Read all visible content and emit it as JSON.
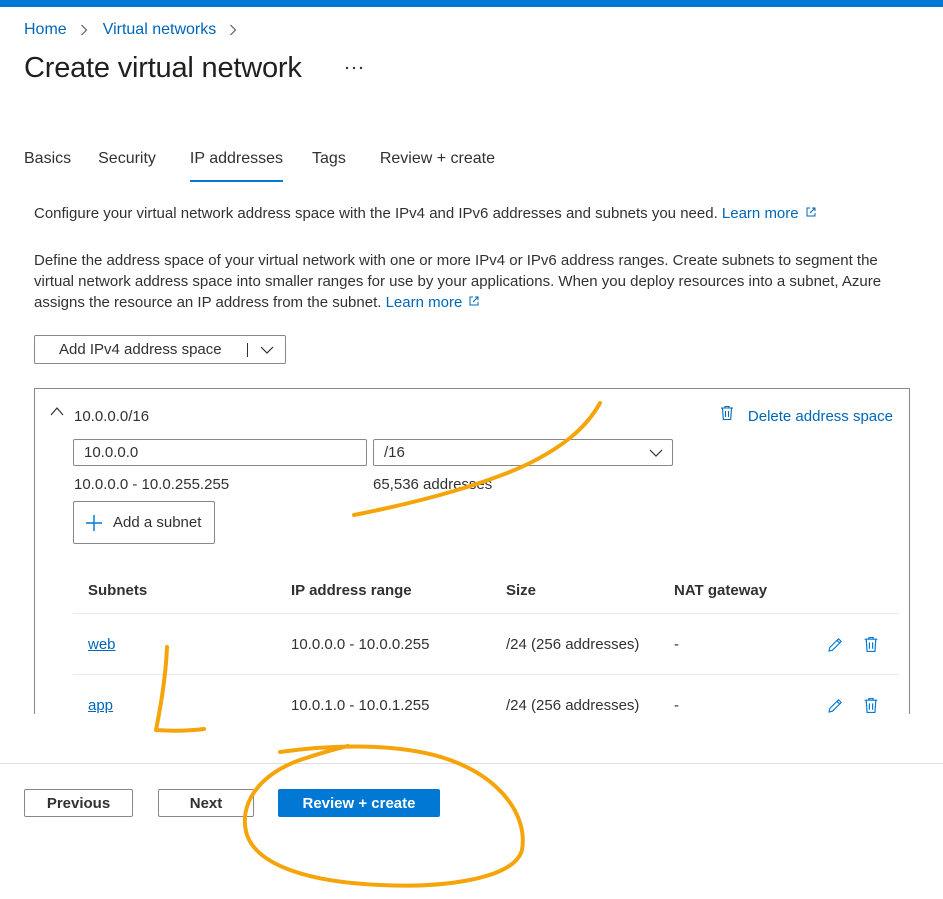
{
  "breadcrumb": {
    "items": [
      "Home",
      "Virtual networks"
    ]
  },
  "page": {
    "title": "Create virtual network",
    "more_label": "···"
  },
  "tabs": [
    {
      "label": "Basics",
      "active": false
    },
    {
      "label": "Security",
      "active": false
    },
    {
      "label": "IP addresses",
      "active": true
    },
    {
      "label": "Tags",
      "active": false
    },
    {
      "label": "Review + create",
      "active": false
    }
  ],
  "intro": {
    "text": "Configure your virtual network address space with the IPv4 and IPv6 addresses and subnets you need.",
    "link": "Learn more"
  },
  "description": {
    "text": "Define the address space of your virtual network with one or more IPv4 or IPv6 address ranges. Create subnets to segment the virtual network address space into smaller ranges for use by your applications. When you deploy resources into a subnet, Azure assigns the resource an IP address from the subnet.",
    "link": "Learn more"
  },
  "add_space_button": "Add IPv4 address space",
  "address_space": {
    "title": "10.0.0.0/16",
    "delete_label": "Delete address space",
    "ip_value": "10.0.0.0",
    "prefix_value": "/16",
    "range": "10.0.0.0 - 10.0.255.255",
    "count": "65,536 addresses",
    "add_subnet_label": "Add a subnet"
  },
  "subnet_table": {
    "headers": [
      "Subnets",
      "IP address range",
      "Size",
      "NAT gateway"
    ],
    "rows": [
      {
        "name": "web",
        "range": "10.0.0.0 - 10.0.0.255",
        "size": "/24 (256 addresses)",
        "nat": "-"
      },
      {
        "name": "app",
        "range": "10.0.1.0 - 10.0.1.255",
        "size": "/24 (256 addresses)",
        "nat": "-"
      }
    ]
  },
  "footer": {
    "previous": "Previous",
    "next": "Next",
    "review": "Review + create"
  },
  "colors": {
    "accent": "#0078d4",
    "link": "#0067b8",
    "annotation": "#f5a50a"
  }
}
